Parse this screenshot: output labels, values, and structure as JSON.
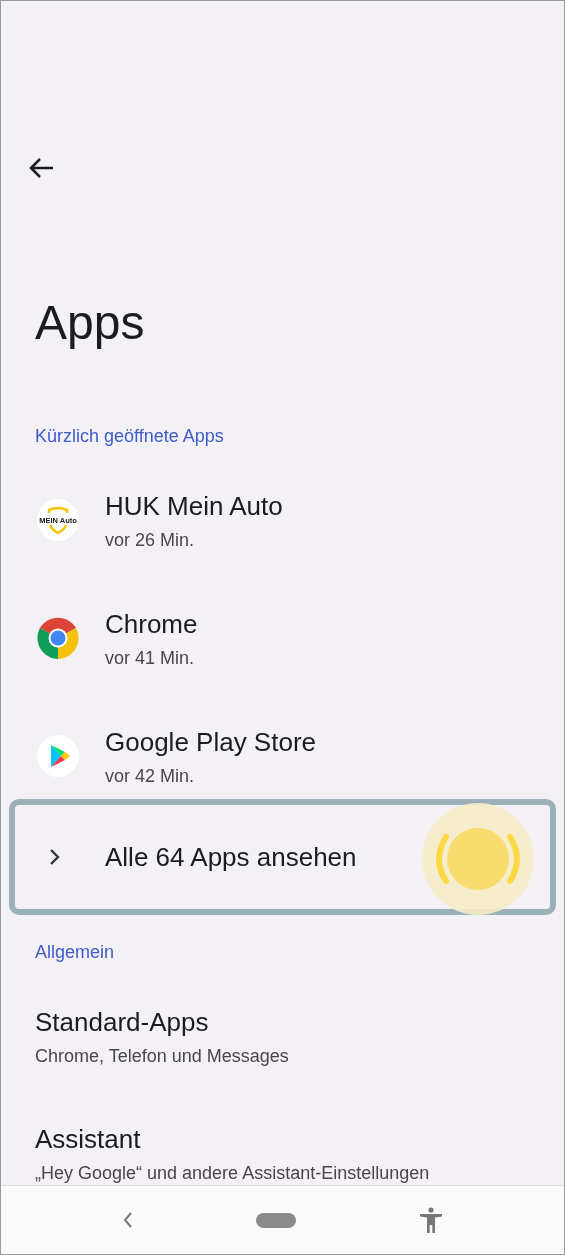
{
  "title": "Apps",
  "sections": [
    {
      "header": "Kürzlich geöffnete Apps",
      "items": [
        {
          "kind": "app",
          "title": "HUK Mein Auto",
          "subtitle": "vor 26 Min.",
          "logo_text": "MEIN Auto"
        },
        {
          "kind": "app",
          "title": "Chrome",
          "subtitle": "vor 41 Min."
        },
        {
          "kind": "app",
          "title": "Google Play Store",
          "subtitle": "vor 42 Min."
        },
        {
          "kind": "link",
          "title": "Alle 64 Apps ansehen",
          "highlighted": true
        }
      ]
    },
    {
      "header": "Allgemein",
      "items": [
        {
          "kind": "setting",
          "title": "Standard-Apps",
          "subtitle": "Chrome, Telefon und Messages"
        },
        {
          "kind": "setting",
          "title": "Assistant",
          "subtitle": "„Hey Google“ und andere Assistant-Einstellungen"
        }
      ]
    }
  ]
}
